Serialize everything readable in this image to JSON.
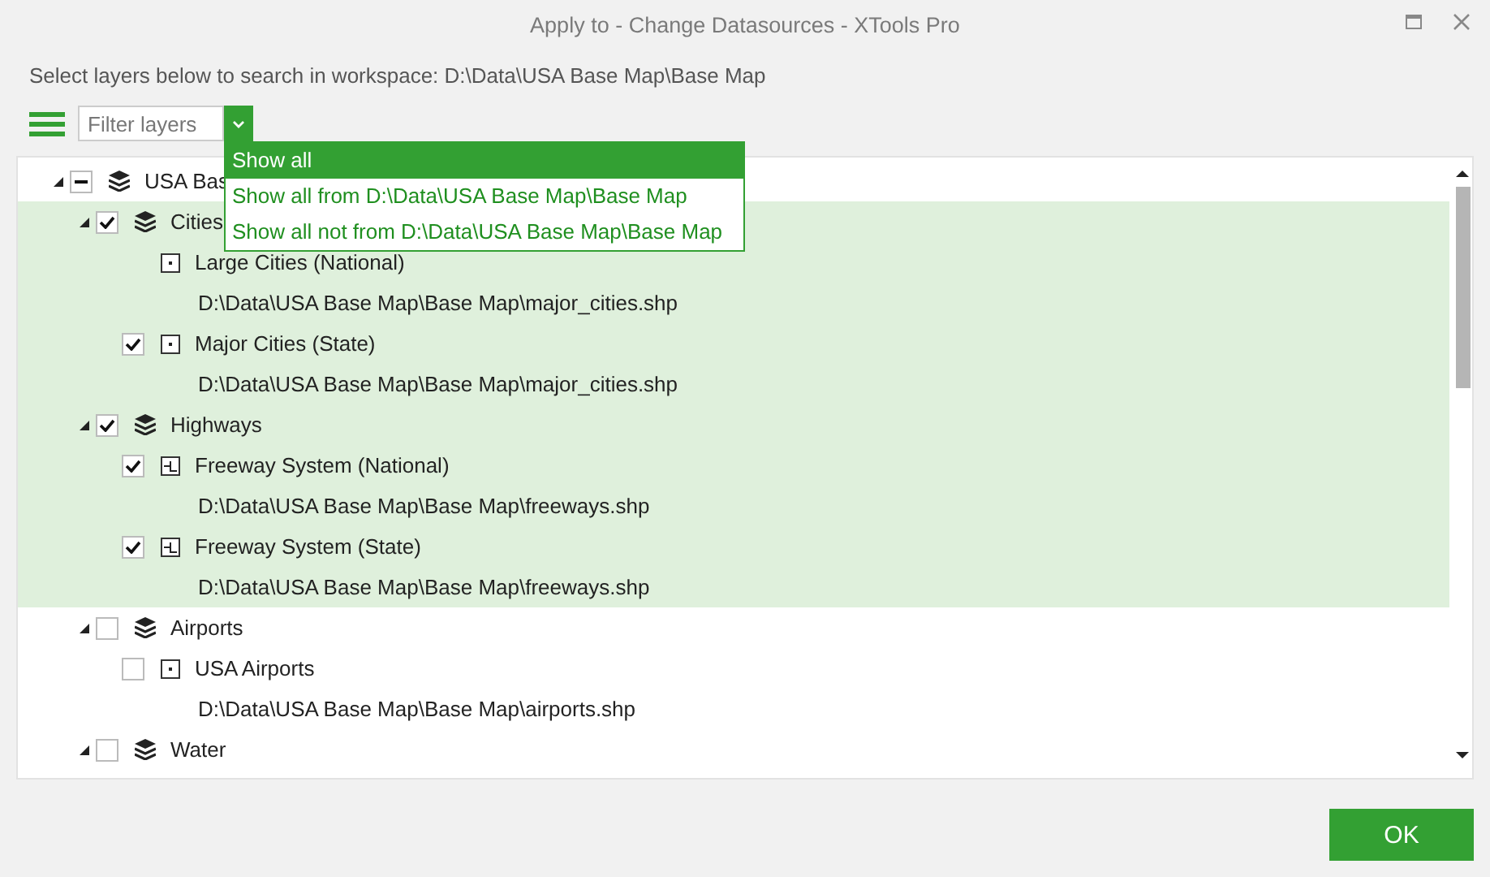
{
  "window": {
    "title": "Apply to - Change Datasources - XTools Pro"
  },
  "instruction": "Select layers below to search in workspace: D:\\Data\\USA Base Map\\Base Map",
  "filter": {
    "placeholder": "Filter layers",
    "menu_open": true
  },
  "filter_menu": [
    {
      "label": "Show all",
      "selected": true
    },
    {
      "label": "Show all from D:\\Data\\USA Base Map\\Base Map",
      "selected": false
    },
    {
      "label": "Show all not from D:\\Data\\USA Base Map\\Base Map",
      "selected": false
    }
  ],
  "tree": {
    "label": "USA Bas",
    "partial": true,
    "expanded": true,
    "children": [
      {
        "label": "Cities",
        "checked": true,
        "expanded": true,
        "highlighted": true,
        "children": [
          {
            "label": "Large Cities (National)",
            "path": "D:\\Data\\USA Base Map\\Base Map\\major_cities.shp",
            "kind": "point"
          },
          {
            "label": "Major Cities (State)",
            "path": "D:\\Data\\USA Base Map\\Base Map\\major_cities.shp",
            "checked": true,
            "kind": "point"
          }
        ]
      },
      {
        "label": "Highways",
        "checked": true,
        "expanded": true,
        "highlighted": true,
        "children": [
          {
            "label": "Freeway System (National)",
            "path": "D:\\Data\\USA Base Map\\Base Map\\freeways.shp",
            "checked": true,
            "kind": "line"
          },
          {
            "label": "Freeway System (State)",
            "path": "D:\\Data\\USA Base Map\\Base Map\\freeways.shp",
            "checked": true,
            "kind": "line"
          }
        ]
      },
      {
        "label": "Airports",
        "checked": false,
        "expanded": true,
        "highlighted": false,
        "children": [
          {
            "label": "USA Airports",
            "path": "D:\\Data\\USA Base Map\\Base Map\\airports.shp",
            "checked": false,
            "kind": "point"
          }
        ]
      },
      {
        "label": "Water",
        "checked": false,
        "expanded": true,
        "highlighted": false
      }
    ]
  },
  "ok_button": "OK"
}
